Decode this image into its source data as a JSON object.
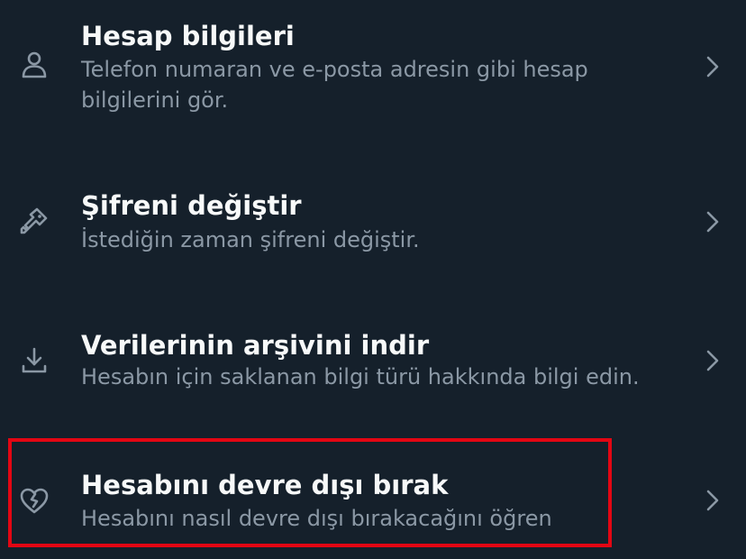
{
  "settings": {
    "items": [
      {
        "icon": "person-icon",
        "title": "Hesap bilgileri",
        "description": "Telefon numaran ve e-posta adresin gibi hesap bilgilerini gör."
      },
      {
        "icon": "key-icon",
        "title": "Şifreni değiştir",
        "description": "İstediğin zaman şifreni değiştir."
      },
      {
        "icon": "download-icon",
        "title": "Verilerinin arşivini indir",
        "description": "Hesabın için saklanan bilgi türü hakkında bilgi edin."
      },
      {
        "icon": "broken-heart-icon",
        "title": "Hesabını devre dışı bırak",
        "description": "Hesabını nasıl devre dışı bırakacağını öğren",
        "highlighted": true
      }
    ]
  },
  "colors": {
    "background": "#15202b",
    "title": "#f7f9f9",
    "description": "#8b98a5",
    "icon": "#8b98a5",
    "highlight": "#e30613"
  }
}
